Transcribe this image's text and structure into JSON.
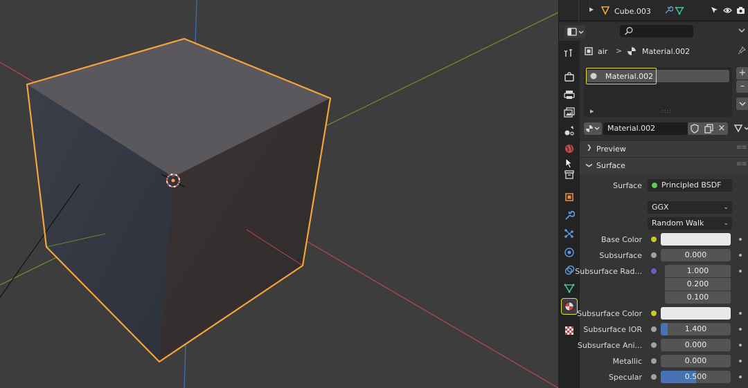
{
  "outliner": {
    "object_name": "Cube.003"
  },
  "breadcrumb": {
    "object_name": "air",
    "separator": ">",
    "material_name": "Material.002"
  },
  "material_slots": {
    "items": [
      {
        "name": "Material.002"
      }
    ],
    "add_label": "+",
    "remove_label": "–"
  },
  "material": {
    "name": "Material.002",
    "unlink_label": "×"
  },
  "panels": {
    "preview": "Preview",
    "surface": "Surface"
  },
  "surface": {
    "surface_label": "Surface",
    "surface_value": "Principled BSDF",
    "distribution": "GGX",
    "subsurface_method": "Random Walk",
    "base_color_label": "Base Color",
    "subsurface_label": "Subsurface",
    "subsurface_value": "0.000",
    "subsurface_radius_label": "Subsurface Rad...",
    "subsurface_radius": [
      "1.000",
      "0.200",
      "0.100"
    ],
    "subsurface_color_label": "Subsurface Color",
    "subsurface_ior_label": "Subsurface IOR",
    "subsurface_ior_value": "1.400",
    "subsurface_ior_fill": 0.1,
    "subsurface_aniso_label": "Subsurface Ani...",
    "subsurface_aniso_value": "0.000",
    "metallic_label": "Metallic",
    "metallic_value": "0.000",
    "specular_label": "Specular",
    "specular_value": "0.500",
    "specular_fill": 0.5
  },
  "colors": {
    "selection_outline": "#f5a33a",
    "active_highlight": "#e5df3a",
    "slider_fill": "#4772b3"
  }
}
